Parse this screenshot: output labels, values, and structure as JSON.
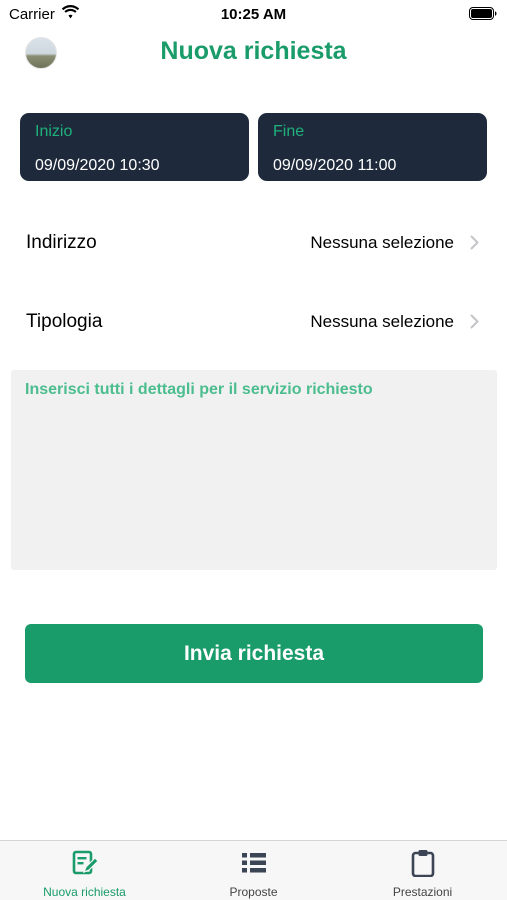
{
  "status_bar": {
    "carrier": "Carrier",
    "time": "10:25 AM"
  },
  "nav": {
    "title": "Nuova richiesta"
  },
  "dates": {
    "start": {
      "label": "Inizio",
      "value": "09/09/2020 10:30"
    },
    "end": {
      "label": "Fine",
      "value": "09/09/2020 11:00"
    }
  },
  "rows": {
    "address": {
      "label": "Indirizzo",
      "value": "Nessuna selezione"
    },
    "type": {
      "label": "Tipologia",
      "value": "Nessuna selezione"
    }
  },
  "details": {
    "placeholder": "Inserisci tutti i dettagli per il servizio richiesto"
  },
  "submit": {
    "label": "Invia richiesta"
  },
  "tabs": [
    {
      "label": "Nuova richiesta",
      "icon": "edit-request-icon",
      "active": true
    },
    {
      "label": "Proposte",
      "icon": "list-icon",
      "active": false
    },
    {
      "label": "Prestazioni",
      "icon": "clipboard-icon",
      "active": false
    }
  ],
  "colors": {
    "accent": "#1a9c6a",
    "card": "#1e2a3b",
    "placeholder": "#4cbd8e"
  }
}
